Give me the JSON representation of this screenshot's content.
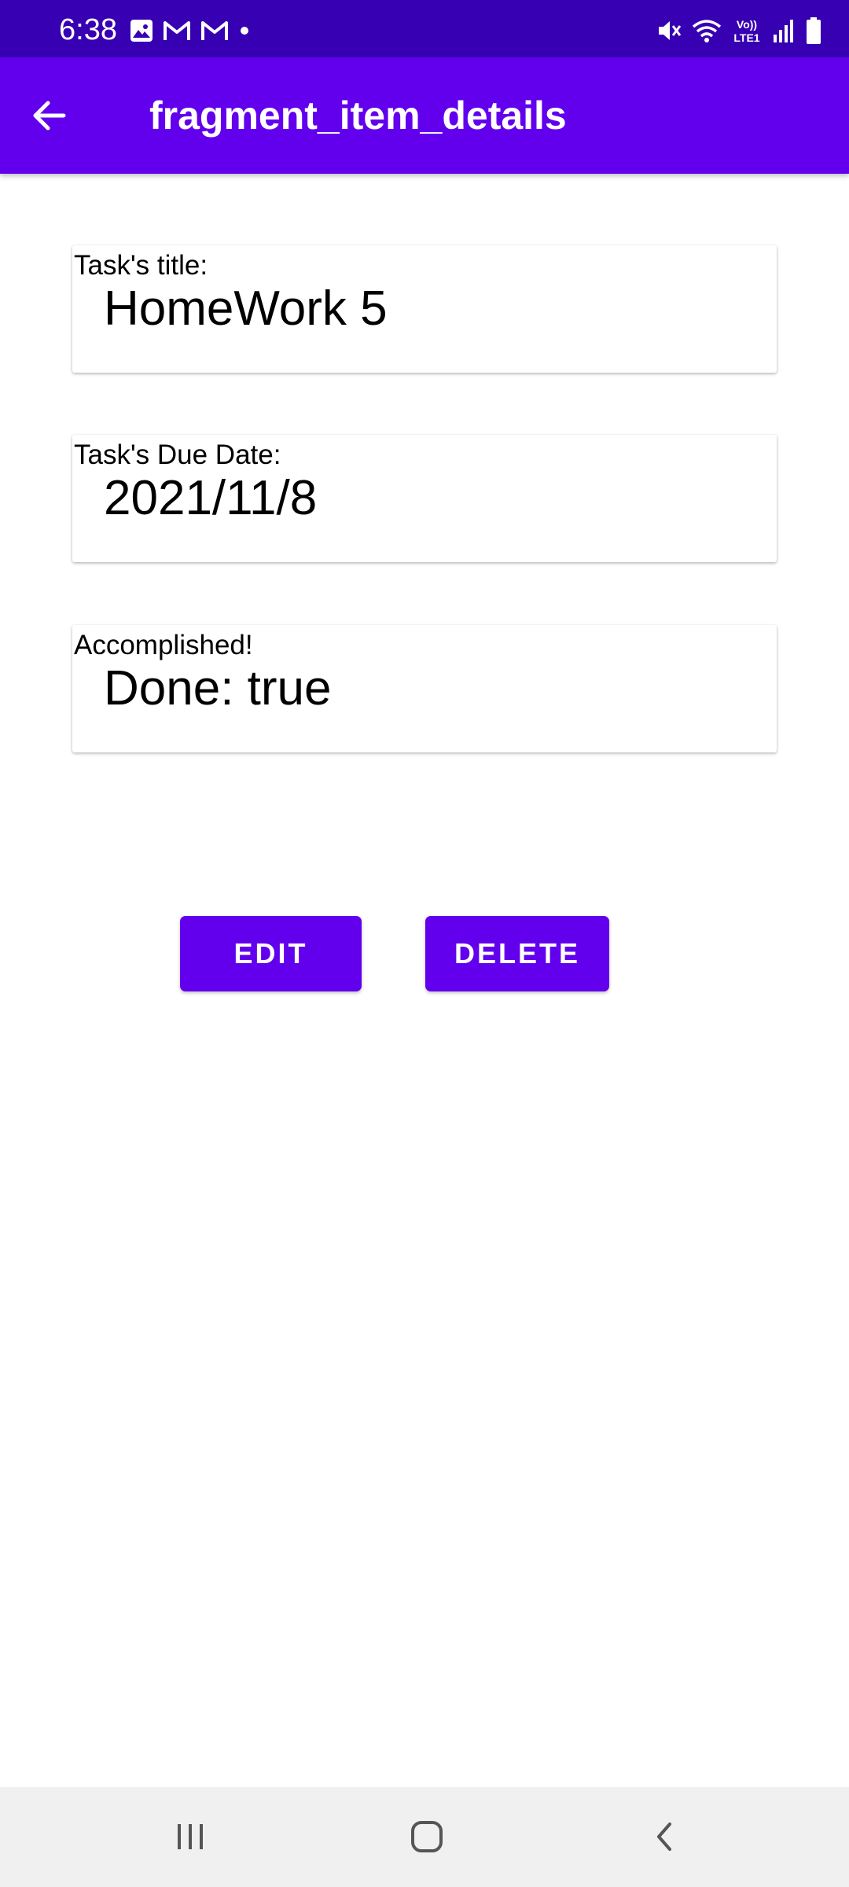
{
  "status_bar": {
    "time": "6:38",
    "left_icons": [
      "gallery-icon",
      "gmail-icon",
      "gmail-icon",
      "dot-icon"
    ],
    "right_icons": [
      "mute-icon",
      "wifi-icon",
      "volte-lte-icon",
      "signal-icon",
      "battery-icon"
    ],
    "volte_text": "Vo))",
    "lte_text": "LTE1"
  },
  "app_bar": {
    "title": "fragment_item_details",
    "back_icon": "arrow-back-icon"
  },
  "cards": {
    "title": {
      "label": "Task's title:",
      "value": "HomeWork 5"
    },
    "due_date": {
      "label": "Task's Due Date:",
      "value": "2021/11/8"
    },
    "done": {
      "label": "Accomplished!",
      "value": "Done: true"
    }
  },
  "buttons": {
    "edit_label": "EDIT",
    "delete_label": "DELETE"
  },
  "nav_bar": {
    "icons": [
      "recents-icon",
      "home-icon",
      "back-icon"
    ]
  },
  "colors": {
    "status_bar": "#3700b3",
    "primary": "#6200ee",
    "nav_bar": "#f0f0f0",
    "text": "#000000"
  }
}
